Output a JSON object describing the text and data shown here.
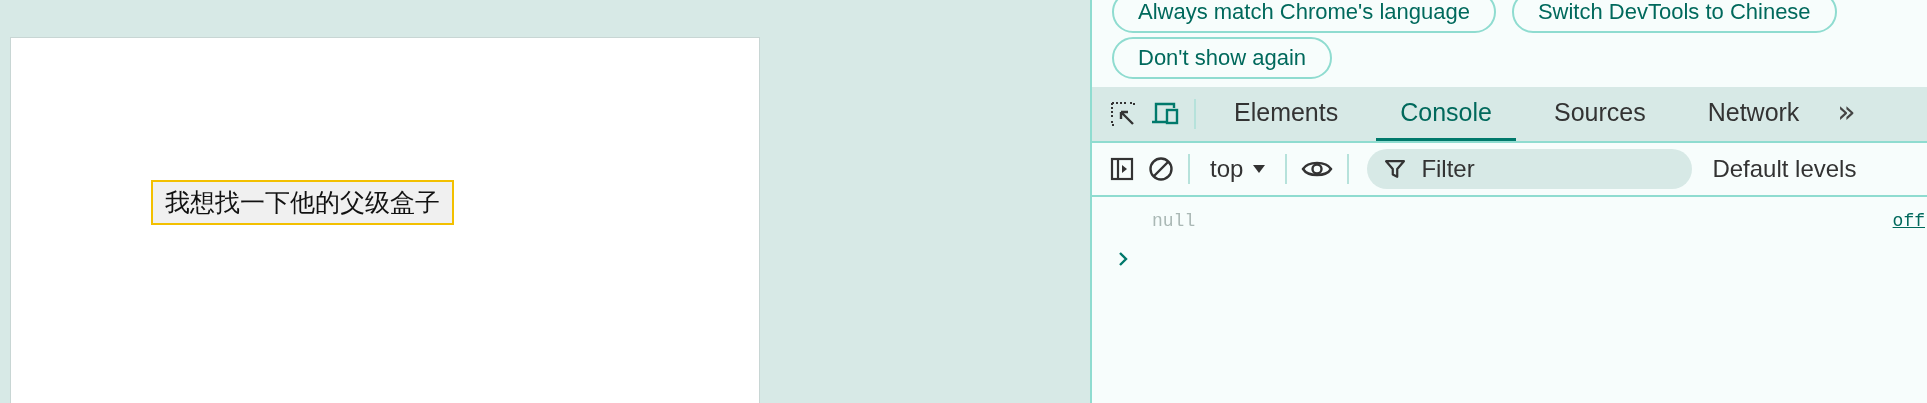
{
  "page": {
    "box_text": "我想找一下他的父级盒子"
  },
  "devtools": {
    "banner_buttons": [
      "Always match Chrome's language",
      "Switch DevTools to Chinese",
      "Don't show again"
    ],
    "tabs": [
      {
        "label": "Elements",
        "selected": false
      },
      {
        "label": "Console",
        "selected": true
      },
      {
        "label": "Sources",
        "selected": false
      },
      {
        "label": "Network",
        "selected": false
      }
    ],
    "more_tabs": "»",
    "context": "top",
    "filter": {
      "placeholder": "Filter"
    },
    "levels": "Default levels",
    "console": [
      {
        "value": "null",
        "source": "off"
      }
    ]
  }
}
